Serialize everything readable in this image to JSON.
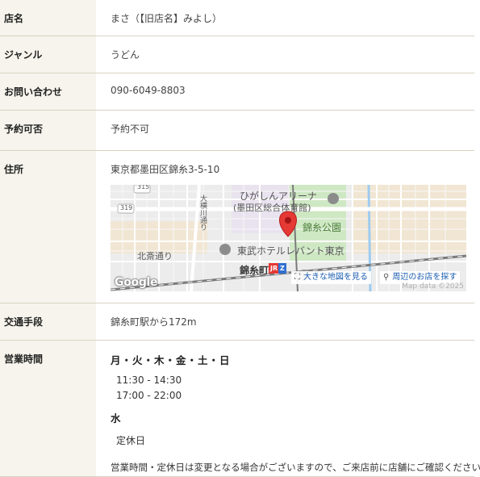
{
  "rows": {
    "name": {
      "label": "店名",
      "value": "まさ（【旧店名】みよし）"
    },
    "genre": {
      "label": "ジャンル",
      "value": "うどん"
    },
    "tel": {
      "label": "お問い合わせ",
      "value": "090-6049-8803"
    },
    "reservation": {
      "label": "予約可否",
      "value": "予約不可"
    },
    "address": {
      "label": "住所",
      "value": "東京都墨田区錦糸3-5-10"
    },
    "access": {
      "label": "交通手段",
      "value": "錦糸町駅から172m"
    },
    "hours": {
      "label": "営業時間",
      "days": "月・火・木・金・土・日",
      "times": [
        "11:30 - 14:30",
        "17:00 - 22:00"
      ],
      "closed_day": "水",
      "closed_text": "定休日",
      "note": "営業時間・定休日は変更となる場合がございますので、ご来店前に店舗にご確認ください。"
    }
  },
  "map": {
    "labels": {
      "arena_line1": "ひがしんアリーナ",
      "arena_line2": "(墨田区総合体育館)",
      "park": "錦糸公園",
      "hotel": "東武ホテルレバント東京",
      "station": "錦糸町",
      "street": "北斎通り",
      "vertical_road": "大横川通り",
      "route_319": "319",
      "route_315": "315"
    },
    "station_badges": {
      "jr": "JR",
      "metro": "Z"
    },
    "google": "Google",
    "larger_map": "大きな地図を見る",
    "nearby": "周辺のお店を探す",
    "attribution": "Map data ©2025",
    "colors": {
      "pin": "#e53935",
      "park": "#cfe8c4",
      "road": "#ffffff",
      "rail": "#8a8a8a"
    }
  }
}
